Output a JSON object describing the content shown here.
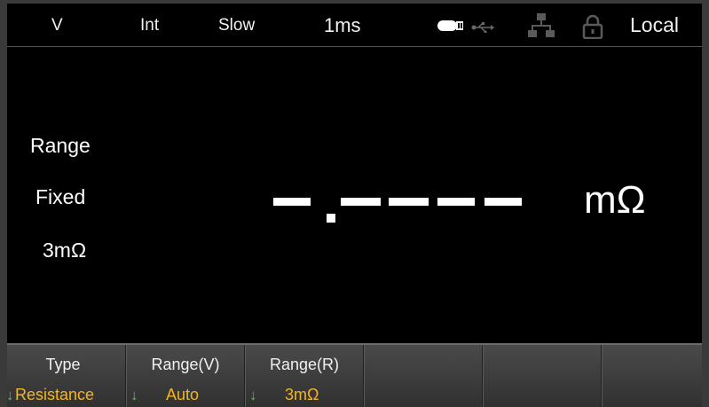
{
  "status_bar": {
    "function": "V",
    "trigger": "Int",
    "speed": "Slow",
    "aperture": "1ms",
    "mode": "Local",
    "icons": [
      "usb-disk-icon",
      "usb-icon",
      "lan-icon",
      "lock-icon"
    ]
  },
  "range_panel": {
    "title": "Range",
    "mode": "Fixed",
    "value": "3mΩ"
  },
  "reading": {
    "display": "–.––––",
    "unit": "mΩ"
  },
  "softkeys": [
    {
      "label": "Type",
      "value": "Resistance",
      "arrow": "↓"
    },
    {
      "label": "Range(V)",
      "value": "Auto",
      "arrow": "↓"
    },
    {
      "label": "Range(R)",
      "value": "3mΩ",
      "arrow": "↓"
    },
    {
      "label": "",
      "value": "",
      "arrow": ""
    },
    {
      "label": "",
      "value": "",
      "arrow": ""
    },
    {
      "label": "",
      "value": "",
      "arrow": ""
    }
  ],
  "colors": {
    "background": "#000000",
    "text": "#ffffff",
    "softkey_value": "#f5b522",
    "softkey_arrow": "#37d24a"
  }
}
